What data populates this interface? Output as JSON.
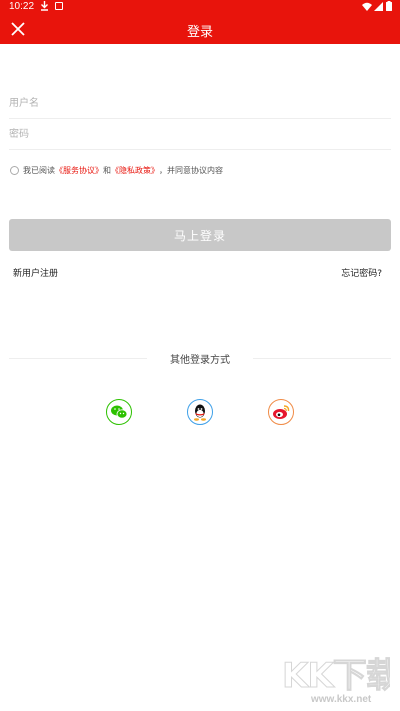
{
  "status_bar": {
    "time": "10:22"
  },
  "header": {
    "title": "登录",
    "bg_color": "#e8140c"
  },
  "form": {
    "username_placeholder": "用户名",
    "password_placeholder": "密码"
  },
  "agreement": {
    "prefix": "我已阅读",
    "service_link": "《服务协议》",
    "and": "和",
    "privacy_link": "《隐私政策》",
    "suffix": "，并同意协议内容",
    "checked": false
  },
  "login_button": "马上登录",
  "register_link": "新用户注册",
  "forgot_link": "忘记密码?",
  "other_login": {
    "label": "其他登录方式",
    "providers": [
      {
        "icon": "wechat-icon",
        "color": "#2dc100"
      },
      {
        "icon": "qq-icon",
        "color": "#3ea0e8"
      },
      {
        "icon": "weibo-icon",
        "color": "#f08b46"
      }
    ]
  },
  "watermark": {
    "logo": "KK下载",
    "url": "www.kkx.net"
  }
}
